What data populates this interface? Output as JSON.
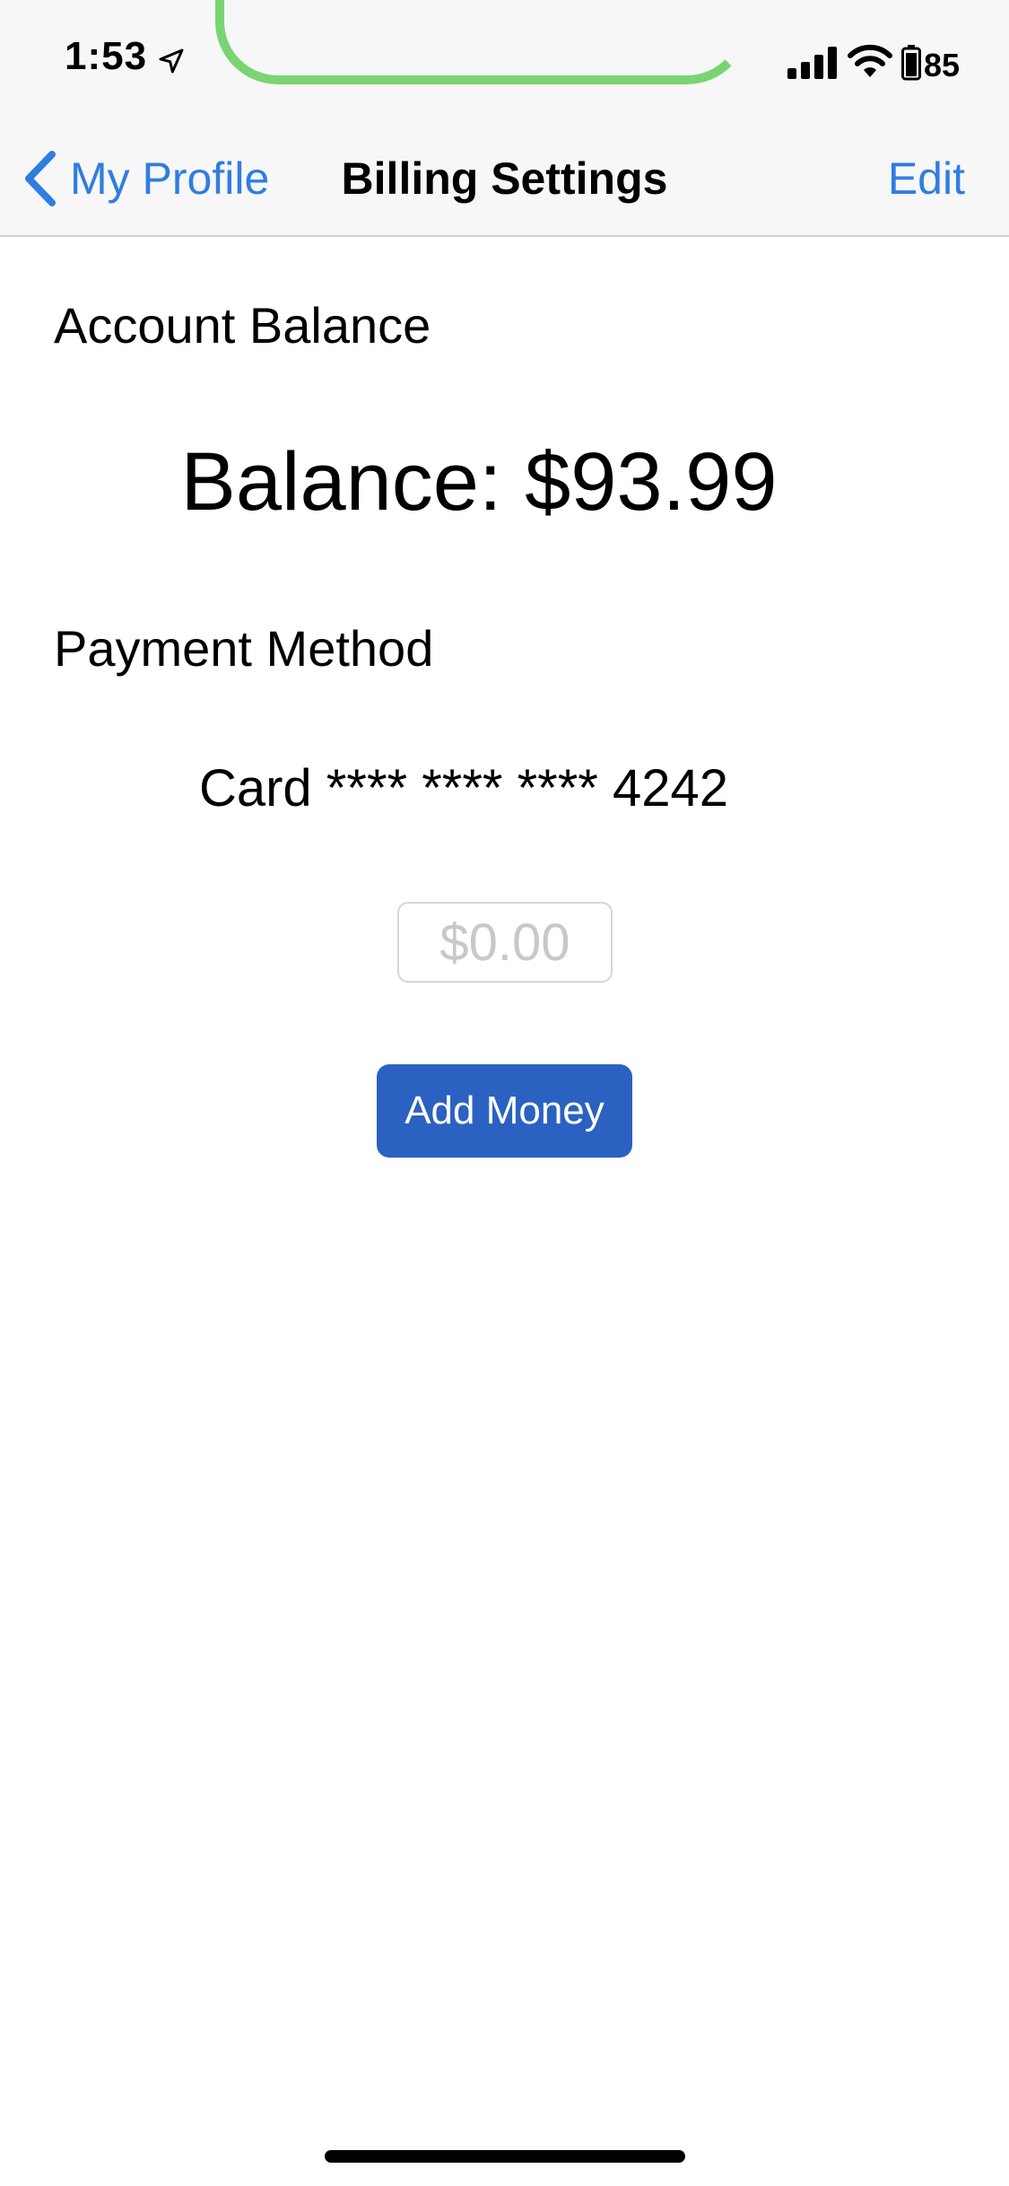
{
  "status_bar": {
    "time": "1:53",
    "battery_percent": "85",
    "icons": [
      "location-arrow-icon",
      "cellular-signal-icon",
      "wifi-icon",
      "battery-icon"
    ]
  },
  "nav": {
    "back_label": "My Profile",
    "title": "Billing Settings",
    "edit_label": "Edit"
  },
  "account": {
    "heading": "Account Balance",
    "balance_text": "Balance: $93.99"
  },
  "payment": {
    "heading": "Payment Method",
    "card_text": "Card **** **** **** 4242"
  },
  "add_money": {
    "amount_placeholder": "$0.00",
    "button_label": "Add Money"
  },
  "colors": {
    "accent": "#2f7de1",
    "button": "#2b62c1",
    "call_indicator": "#7ad474"
  }
}
